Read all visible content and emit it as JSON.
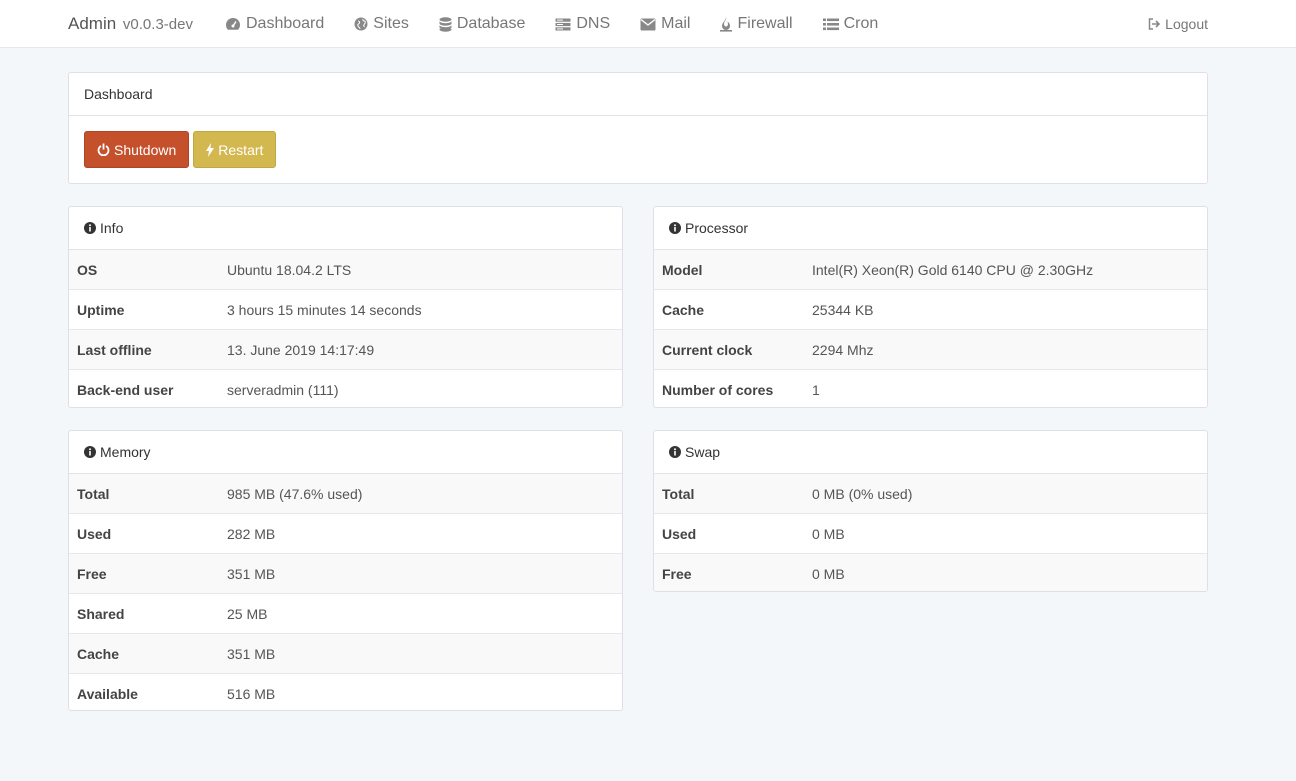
{
  "navbar": {
    "brand": "Admin",
    "version": "v0.0.3-dev",
    "items": [
      {
        "label": "Dashboard",
        "icon": "dashboard-icon"
      },
      {
        "label": "Sites",
        "icon": "globe-icon"
      },
      {
        "label": "Database",
        "icon": "database-icon"
      },
      {
        "label": "DNS",
        "icon": "server-icon"
      },
      {
        "label": "Mail",
        "icon": "envelope-icon"
      },
      {
        "label": "Firewall",
        "icon": "fire-icon"
      },
      {
        "label": "Cron",
        "icon": "list-icon"
      }
    ],
    "logout": "Logout"
  },
  "dashboard": {
    "title": "Dashboard",
    "shutdown": "Shutdown",
    "restart": "Restart",
    "colors": {
      "shutdown": "#c5512c",
      "restart": "#d3b84f"
    }
  },
  "info": {
    "title": "Info",
    "rows": [
      {
        "key": "OS",
        "value": "Ubuntu 18.04.2 LTS"
      },
      {
        "key": "Uptime",
        "value": "3 hours 15 minutes 14 seconds"
      },
      {
        "key": "Last offline",
        "value": "13. June 2019 14:17:49"
      },
      {
        "key": "Back-end user",
        "value": "serveradmin (111)"
      }
    ]
  },
  "processor": {
    "title": "Processor",
    "rows": [
      {
        "key": "Model",
        "value": "Intel(R) Xeon(R) Gold 6140 CPU @ 2.30GHz"
      },
      {
        "key": "Cache",
        "value": "25344 KB"
      },
      {
        "key": "Current clock",
        "value": "2294 Mhz"
      },
      {
        "key": "Number of cores",
        "value": "1"
      }
    ]
  },
  "memory": {
    "title": "Memory",
    "rows": [
      {
        "key": "Total",
        "value": "985 MB (47.6% used)"
      },
      {
        "key": "Used",
        "value": "282 MB"
      },
      {
        "key": "Free",
        "value": "351 MB"
      },
      {
        "key": "Shared",
        "value": "25 MB"
      },
      {
        "key": "Cache",
        "value": "351 MB"
      },
      {
        "key": "Available",
        "value": "516 MB"
      }
    ]
  },
  "swap": {
    "title": "Swap",
    "rows": [
      {
        "key": "Total",
        "value": "0 MB (0% used)"
      },
      {
        "key": "Used",
        "value": "0 MB"
      },
      {
        "key": "Free",
        "value": "0 MB"
      }
    ]
  }
}
